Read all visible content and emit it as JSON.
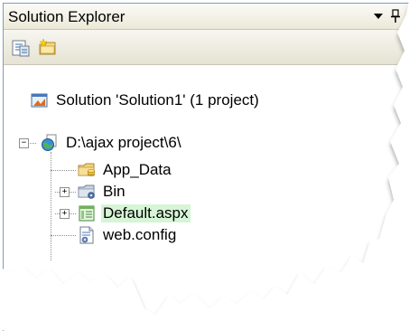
{
  "window": {
    "title": "Solution Explorer"
  },
  "icons": {
    "menu": "chevron-down-icon",
    "pin": "pin-icon",
    "toolbar": [
      "properties-icon",
      "show-all-files-icon"
    ]
  },
  "tree": {
    "solution": {
      "label": "Solution 'Solution1' (1 project)",
      "icon": "solution-icon"
    },
    "project": {
      "label": "D:\\ajax project\\6\\",
      "icon": "web-project-icon",
      "expanded": true
    },
    "children": [
      {
        "label": "App_Data",
        "icon": "folder-icon",
        "expandable": false
      },
      {
        "label": "Bin",
        "icon": "bin-folder-icon",
        "expandable": true
      },
      {
        "label": "Default.aspx",
        "icon": "aspx-file-icon",
        "expandable": true,
        "selected": true
      },
      {
        "label": "web.config",
        "icon": "config-file-icon",
        "expandable": false
      }
    ]
  },
  "colors": {
    "selection": "#d6f5d6",
    "title_bar": "#ece9d8"
  }
}
